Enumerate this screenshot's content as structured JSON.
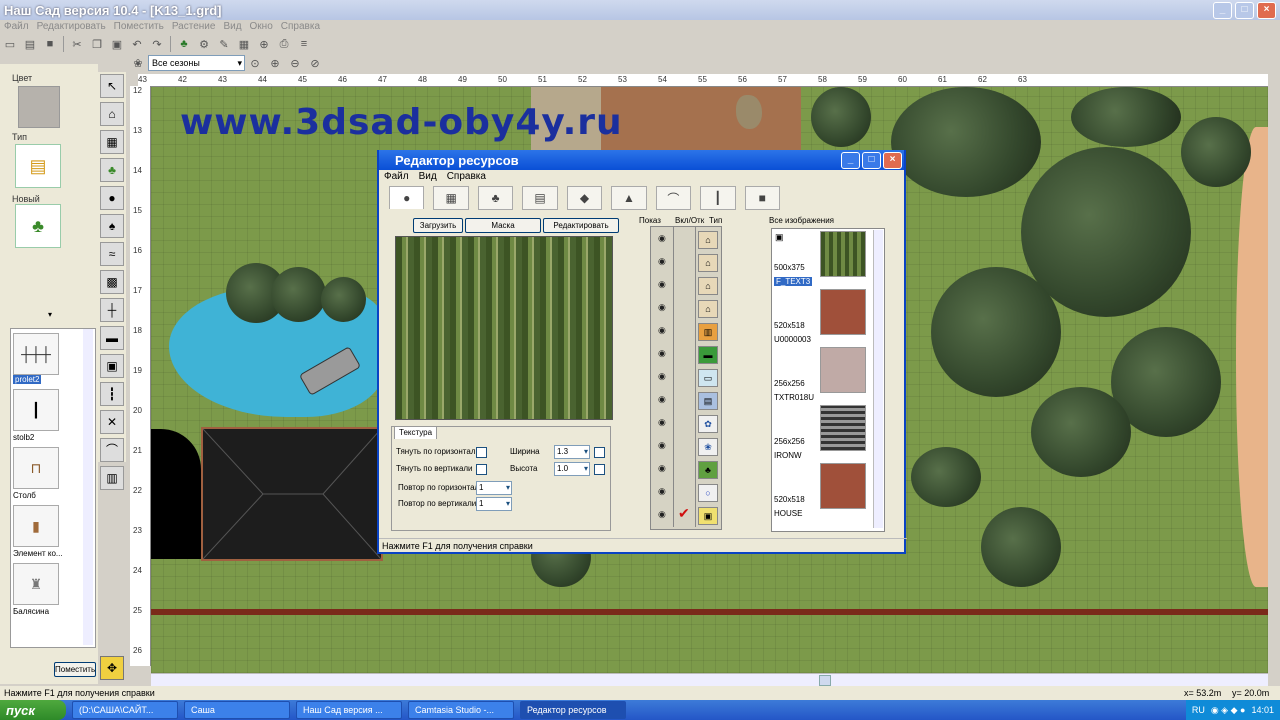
{
  "app": {
    "title": "Наш Сад версия 10.4 - [K13_1.grd]",
    "menu": [
      "Файл",
      "Редактировать",
      "Поместить",
      "Растение",
      "Вид",
      "Окно",
      "Справка"
    ],
    "season_select": "Все сезоны",
    "watermark": "www.3dsad-oby4y.ru"
  },
  "left_panel": {
    "color_label": "Цвет",
    "type_label": "Тип",
    "new_label": "Новый",
    "items": [
      "prolet2",
      "stolb2",
      "Столб",
      "Элемент ко...",
      "Балясина"
    ],
    "place_button": "Поместить"
  },
  "rulers": {
    "top": [
      "43",
      "42",
      "43",
      "44",
      "45",
      "46",
      "47",
      "48",
      "49",
      "50",
      "51",
      "52",
      "53",
      "54",
      "55",
      "56",
      "57",
      "58",
      "59",
      "60",
      "61",
      "62",
      "63"
    ],
    "left": [
      "12",
      "13",
      "14",
      "15",
      "16",
      "17",
      "18",
      "19",
      "20",
      "21",
      "22",
      "23",
      "24",
      "25",
      "26"
    ]
  },
  "dialog": {
    "title": "Редактор ресурсов",
    "menu": [
      "Файл",
      "Вид",
      "Справка"
    ],
    "buttons": {
      "load": "Загрузить",
      "mask": "Маска прозрачности",
      "edit": "Редактировать"
    },
    "texture_tab": "Текстура",
    "stretch_h": "Тянуть по горизонтали",
    "stretch_v": "Тянуть по вертикали",
    "width_label": "Ширина",
    "height_label": "Высота",
    "width_value": "1.3",
    "height_value": "1.0",
    "repeat_h": "Повтор по горизонтали",
    "repeat_v": "Повтор по вертикали",
    "repeat_h_value": "1",
    "repeat_v_value": "1",
    "col_show": "Показ",
    "col_onoff": "Вкл/Отк",
    "col_type": "Тип",
    "all_images": "Все изображения",
    "images": [
      {
        "size": "500x375",
        "name": "F_TEXT3"
      },
      {
        "size": "520x518",
        "name": "U0000003"
      },
      {
        "size": "256x256",
        "name": "TXTR018U"
      },
      {
        "size": "256x256",
        "name": "IRONW"
      },
      {
        "size": "520x518",
        "name": "HOUSE"
      }
    ],
    "status": "Нажмите F1 для получения справки"
  },
  "status": {
    "help": "Нажмите F1 для получения справки",
    "x": "x= 53.2m",
    "y": "y= 20.0m"
  },
  "taskbar": {
    "start": "пуск",
    "tasks": [
      "(D:\\САША\\САЙТ...",
      "Саша",
      "Наш Сад версия ...",
      "Camtasia Studio -...",
      "Редактор ресурсов"
    ],
    "lang": "RU",
    "clock": "14:01"
  }
}
